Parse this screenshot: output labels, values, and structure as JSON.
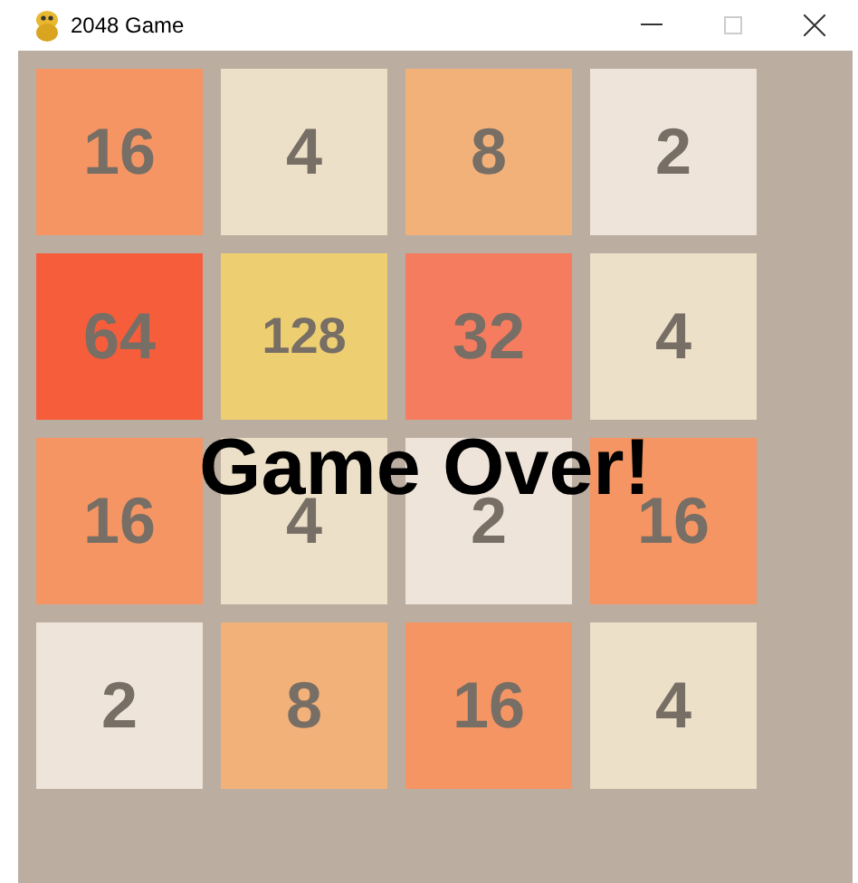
{
  "window": {
    "title": "2048 Game"
  },
  "tiles": [
    {
      "value": "16",
      "color": "#f59563"
    },
    {
      "value": "4",
      "color": "#ede0c8"
    },
    {
      "value": "8",
      "color": "#f2b179"
    },
    {
      "value": "2",
      "color": "#eee4da"
    },
    {
      "value": "64",
      "color": "#f65e3b"
    },
    {
      "value": "128",
      "color": "#edcf72"
    },
    {
      "value": "32",
      "color": "#f67c5f"
    },
    {
      "value": "4",
      "color": "#ede0c8"
    },
    {
      "value": "16",
      "color": "#f59563"
    },
    {
      "value": "4",
      "color": "#ede0c8"
    },
    {
      "value": "2",
      "color": "#eee4da"
    },
    {
      "value": "16",
      "color": "#f59563"
    },
    {
      "value": "2",
      "color": "#eee4da"
    },
    {
      "value": "8",
      "color": "#f2b179"
    },
    {
      "value": "16",
      "color": "#f59563"
    },
    {
      "value": "4",
      "color": "#ede0c8"
    }
  ],
  "message": "Game Over!"
}
